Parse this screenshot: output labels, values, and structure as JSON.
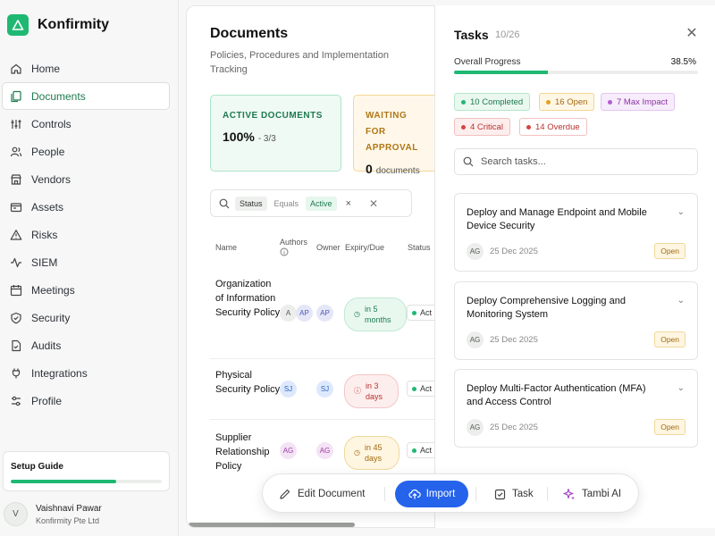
{
  "brand": {
    "name": "Konfirmity"
  },
  "sidebar": {
    "items": [
      {
        "label": "Home",
        "icon": "home-icon"
      },
      {
        "label": "Documents",
        "icon": "documents-icon",
        "active": true
      },
      {
        "label": "Controls",
        "icon": "sliders-icon"
      },
      {
        "label": "People",
        "icon": "people-icon"
      },
      {
        "label": "Vendors",
        "icon": "store-icon"
      },
      {
        "label": "Assets",
        "icon": "assets-icon"
      },
      {
        "label": "Risks",
        "icon": "warning-icon"
      },
      {
        "label": "SIEM",
        "icon": "activity-icon"
      },
      {
        "label": "Meetings",
        "icon": "calendar-icon"
      },
      {
        "label": "Security",
        "icon": "shield-icon"
      },
      {
        "label": "Audits",
        "icon": "audit-file-icon"
      },
      {
        "label": "Integrations",
        "icon": "plug-icon"
      },
      {
        "label": "Profile",
        "icon": "profile-settings-icon"
      }
    ],
    "setup_guide": {
      "title": "Setup Guide",
      "progress": 0.7
    },
    "user": {
      "initial": "V",
      "name": "Vaishnavi Pawar",
      "org": "Konfirmity Pte Ltd"
    }
  },
  "documents": {
    "title": "Documents",
    "subtitle": "Policies, Procedures and Implementation Tracking",
    "stats": {
      "active": {
        "label": "ACTIVE DOCUMENTS",
        "value": "100%",
        "sub": "- 3/3"
      },
      "waiting": {
        "label": "WAITING FOR APPROVAL",
        "value": "0",
        "sub": "documents"
      }
    },
    "filter": {
      "field": "Status",
      "op": "Equals",
      "value": "Active",
      "remove": "×",
      "clear": "✕"
    },
    "columns": {
      "name": "Name",
      "authors": "Authors",
      "owner": "Owner",
      "due": "Expiry/Due",
      "status": "Status"
    },
    "rows": [
      {
        "name": "Organization of Information Security Policy",
        "authors": [
          "A",
          "AP"
        ],
        "owner": "AP",
        "due": "in 5 months",
        "status": "Act"
      },
      {
        "name": "Physical Security Policy",
        "authors": [
          "SJ"
        ],
        "owner": "SJ",
        "due": "in 3 days",
        "status": "Act"
      },
      {
        "name": "Supplier Relationship Policy",
        "authors": [
          "AG"
        ],
        "owner": "AG",
        "due": "in 45 days",
        "status": "Act"
      }
    ]
  },
  "tasks": {
    "title": "Tasks",
    "count": "10/26",
    "close": "✕",
    "progress": {
      "label": "Overall Progress",
      "value": "38.5%",
      "fraction": 0.385
    },
    "tags": {
      "completed": "10 Completed",
      "open": "16 Open",
      "max_impact": "7 Max Impact",
      "critical": "4 Critical",
      "overdue": "14 Overdue"
    },
    "search_placeholder": "Search tasks...",
    "items": [
      {
        "name": "Deploy and Manage Endpoint and Mobile Device Security",
        "assignee": "AG",
        "date": "25 Dec 2025",
        "status": "Open"
      },
      {
        "name": "Deploy Comprehensive Logging and Monitoring System",
        "assignee": "AG",
        "date": "25 Dec 2025",
        "status": "Open"
      },
      {
        "name": "Deploy Multi-Factor Authentication (MFA) and Access Control",
        "assignee": "AG",
        "date": "25 Dec 2025",
        "status": "Open"
      }
    ]
  },
  "actions": {
    "edit": "Edit Document",
    "import": "Import",
    "task": "Task",
    "ai": "Tambi AI"
  },
  "colors": {
    "brand": "#1fb872",
    "primary": "#2563eb"
  }
}
